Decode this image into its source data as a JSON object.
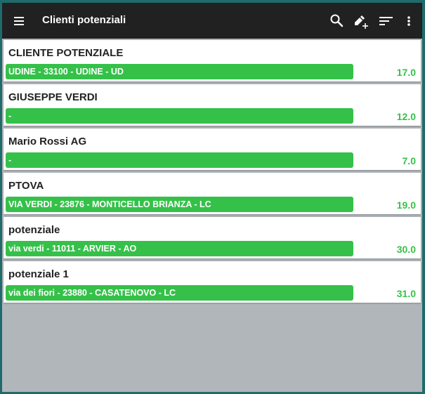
{
  "appbar": {
    "title": "Clienti potenziali",
    "icons": [
      "menu-icon",
      "search-icon",
      "edit-add-icon",
      "sort-icon",
      "more-vert-icon"
    ]
  },
  "colors": {
    "appbar": "#212121",
    "accent": "#35c149",
    "background": "#b1b6bb"
  },
  "clients": [
    {
      "name": "CLIENTE POTENZIALE",
      "address": "UDINE - 33100 - UDINE - UD",
      "value": "17.0"
    },
    {
      "name": "GIUSEPPE VERDI",
      "address": "-",
      "value": "12.0"
    },
    {
      "name": "Mario Rossi AG",
      "address": "-",
      "value": "7.0"
    },
    {
      "name": "PTOVA",
      "address": "VIA VERDI - 23876 - MONTICELLO BRIANZA - LC",
      "value": "19.0"
    },
    {
      "name": "potenziale",
      "address": "via verdi - 11011 - ARVIER - AO",
      "value": "30.0"
    },
    {
      "name": "potenziale 1",
      "address": "via dei fiori - 23880 - CASATENOVO - LC",
      "value": "31.0"
    }
  ]
}
